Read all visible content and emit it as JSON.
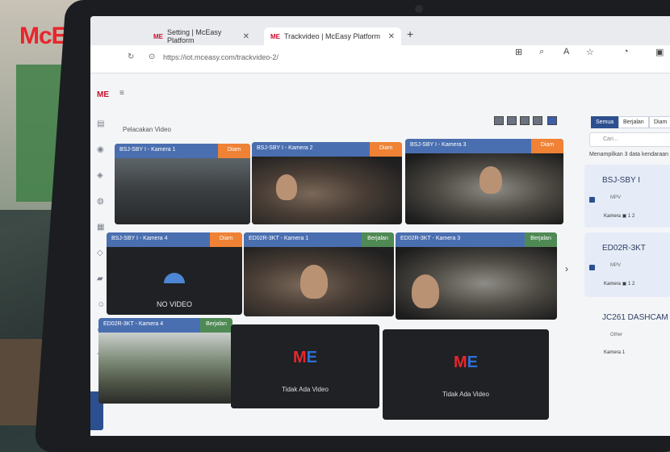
{
  "brand": {
    "logo_text": "McEasy"
  },
  "browser": {
    "tabs": [
      {
        "label": "Setting | McEasy Platform",
        "favicon": "ME"
      },
      {
        "label": "Trackvideo | McEasy Platform",
        "favicon": "ME"
      }
    ],
    "url": "https://iot.mceasy.com/trackvideo-2/"
  },
  "app": {
    "logo": "ME",
    "page_title": "Pelacakan Video",
    "tiles": [
      {
        "name": "BSJ-SBY I - Kamera 1",
        "status": "Diam",
        "status_color": "#ef8235",
        "feed": "road"
      },
      {
        "name": "BSJ-SBY I - Kamera 2",
        "status": "Diam",
        "status_color": "#ef8235",
        "feed": "cab"
      },
      {
        "name": "BSJ-SBY I - Kamera 3",
        "status": "Diam",
        "status_color": "#ef8235",
        "feed": "cab2"
      },
      {
        "name": "BSJ-SBY I - Kamera 4",
        "status": "Diam",
        "status_color": "#ef8235",
        "feed": "novideo",
        "feed_text": "NO VIDEO"
      },
      {
        "name": "ED02R-3KT - Kamera 1",
        "status": "Berjalan",
        "status_color": "#4f8a55",
        "feed": "cab"
      },
      {
        "name": "ED02R-3KT - Kamera 3",
        "status": "Berjalan",
        "status_color": "#4f8a55",
        "feed": "cab2"
      },
      {
        "name": "ED02R-3KT - Kamera 4",
        "status": "Berjalan",
        "status_color": "#4f8a55",
        "feed": "street"
      },
      {
        "name": "",
        "status": "",
        "feed": "empty",
        "feed_text": "Tidak Ada Video"
      },
      {
        "name": "",
        "status": "",
        "feed": "empty",
        "feed_text": "Tidak Ada Video"
      }
    ],
    "filters": [
      "Semua",
      "Berjalan",
      "Diam"
    ],
    "search_placeholder": "Cari...",
    "count_text": "Menampilkan 3 data kendaraan",
    "vehicles": [
      {
        "title": "BSJ-SBY I",
        "type": "MPV",
        "camera_label": "Kamera",
        "cameras": "1 2"
      },
      {
        "title": "ED02R-3KT",
        "type": "MPV",
        "camera_label": "Kamera",
        "cameras": "1 2"
      },
      {
        "title": "JC261 DASHCAM",
        "type": "Other",
        "camera_label": "Kamera",
        "cameras": "1"
      }
    ]
  }
}
